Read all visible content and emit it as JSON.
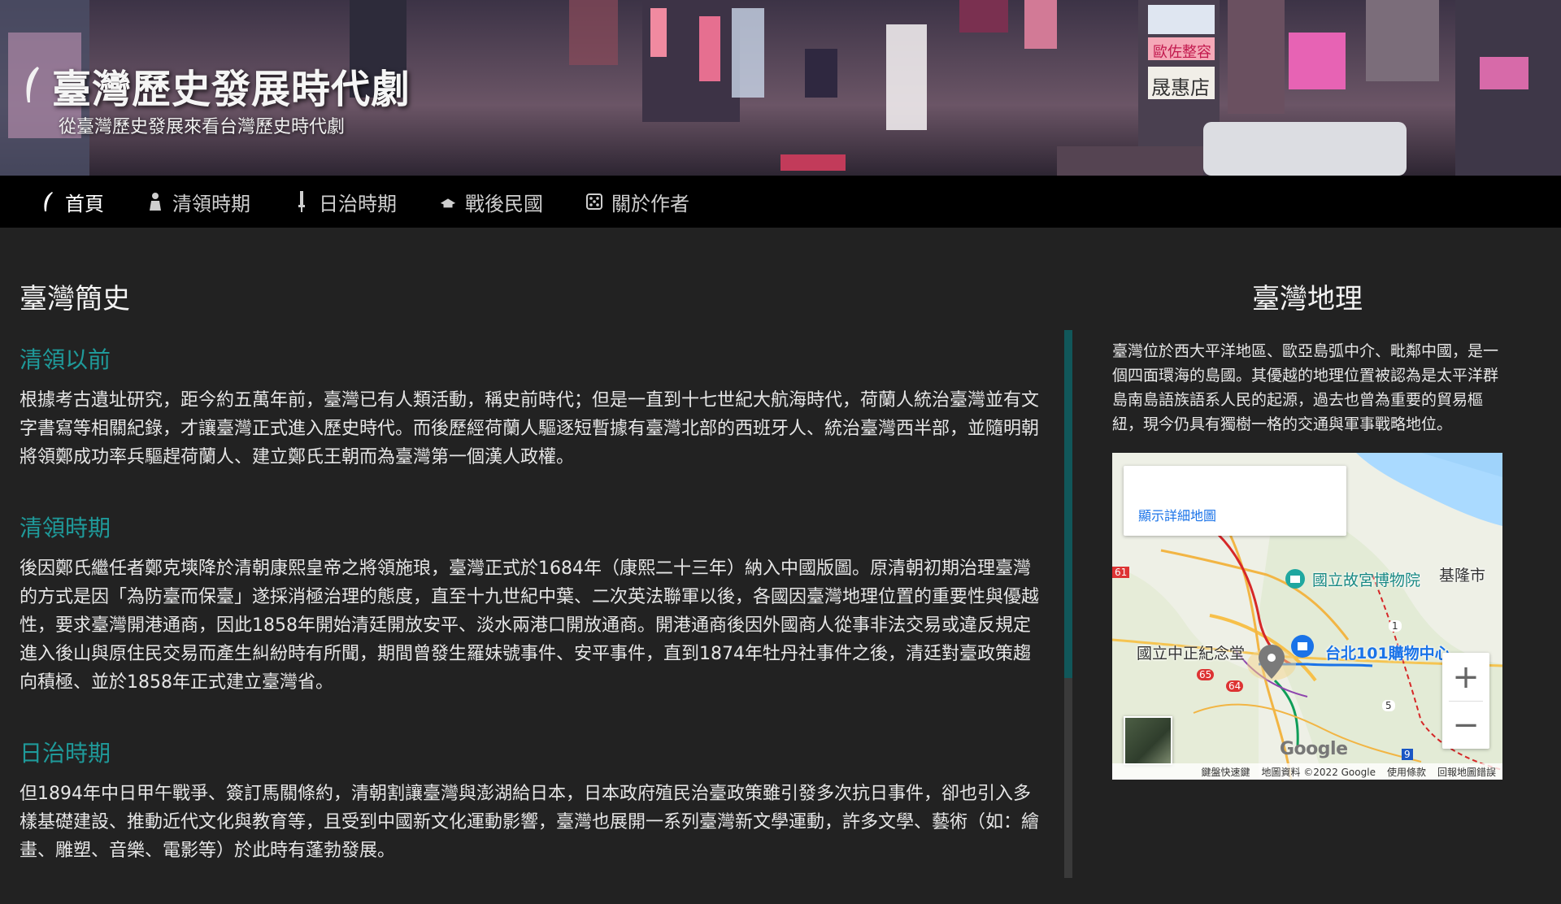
{
  "hero": {
    "title": "臺灣歷史發展時代劇",
    "subtitle": "從臺灣歷史發展來看台灣歷史時代劇",
    "sign_text_1": "歐佐整容",
    "sign_text_2": "晟惠店"
  },
  "nav": {
    "items": [
      {
        "label": "首頁",
        "icon": "feather-icon"
      },
      {
        "label": "清領時期",
        "icon": "figure-icon"
      },
      {
        "label": "日治時期",
        "icon": "sword-icon"
      },
      {
        "label": "戰後民國",
        "icon": "hat-icon"
      },
      {
        "label": "關於作者",
        "icon": "dice-icon"
      }
    ]
  },
  "main": {
    "heading": "臺灣簡史",
    "sections": [
      {
        "title": "清領以前",
        "body": "根據考古遺址研究，距今約五萬年前，臺灣已有人類活動，稱史前時代；但是一直到十七世紀大航海時代，荷蘭人統治臺灣並有文字書寫等相關紀錄，才讓臺灣正式進入歷史時代。而後歷經荷蘭人驅逐短暫據有臺灣北部的西班牙人、統治臺灣西半部，並隨明朝將領鄭成功率兵驅趕荷蘭人、建立鄭氏王朝而為臺灣第一個漢人政權。"
      },
      {
        "title": "清領時期",
        "body": "後因鄭氏繼任者鄭克塽降於清朝康熙皇帝之將領施琅，臺灣正式於1684年（康熙二十三年）納入中國版圖。原清朝初期治理臺灣的方式是因「為防臺而保臺」遂採消極治理的態度，直至十九世紀中葉、二次英法聯軍以後，各國因臺灣地理位置的重要性與優越性，要求臺灣開港通商，因此1858年開始清廷開放安平、淡水兩港口開放通商。開港通商後因外國商人從事非法交易或違反規定進入後山與原住民交易而產生糾紛時有所聞，期間曾發生羅妹號事件、安平事件，直到1874年牡丹社事件之後，清廷對臺政策趨向積極、並於1858年正式建立臺灣省。"
      },
      {
        "title": "日治時期",
        "body": "但1894年中日甲午戰爭、簽訂馬關條約，清朝割讓臺灣與澎湖給日本，日本政府殖民治臺政策雖引發多次抗日事件，卻也引入多樣基礎建設、推動近代文化與教育等，且受到中國新文化運動影響，臺灣也展開一系列臺灣新文學運動，許多文學、藝術（如：繪畫、雕塑、音樂、電影等）於此時有蓬勃發展。"
      }
    ]
  },
  "aside": {
    "heading": "臺灣地理",
    "body": "臺灣位於西大平洋地區、歐亞島弧中介、毗鄰中國，是一個四面環海的島國。其優越的地理位置被認為是太平洋群島南島語族語系人民的起源，過去也曾為重要的貿易樞紐，現今仍具有獨樹一格的交通與軍事戰略地位。"
  },
  "map": {
    "larger_map_link": "顯示詳細地圖",
    "labels": {
      "palace_museum": "國立故宮博物院",
      "keelung": "基隆市",
      "cks_memorial": "國立中正紀念堂",
      "taipei101": "台北101購物中心"
    },
    "road_numbers": [
      "61",
      "1",
      "65",
      "64",
      "5",
      "9"
    ],
    "zoom_in": "+",
    "zoom_out": "−",
    "google": "Google",
    "attribution": {
      "shortcuts": "鍵盤快速鍵",
      "data": "地圖資料 ©2022 Google",
      "terms": "使用條款",
      "report": "回報地圖錯誤"
    }
  },
  "colors": {
    "accent": "#1f9a9a",
    "background": "#222222",
    "nav_background": "#000000",
    "scroll_thumb": "#11575a"
  }
}
